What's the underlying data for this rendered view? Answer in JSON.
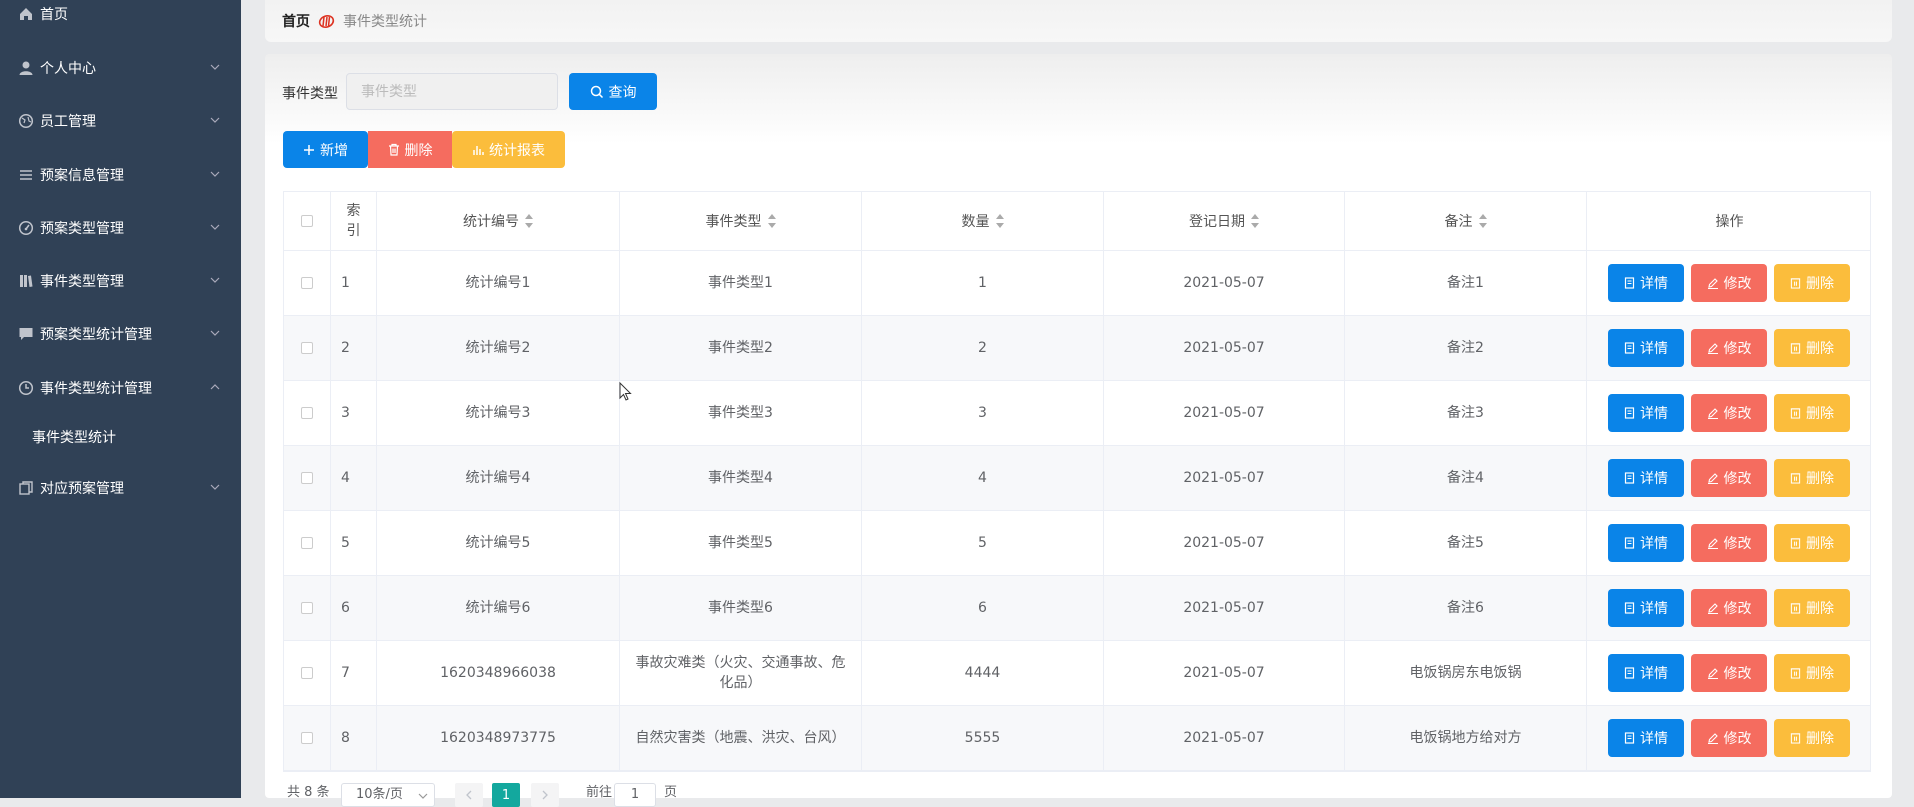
{
  "sidebar": {
    "items": [
      {
        "label": "首页",
        "icon": "home-icon"
      },
      {
        "label": "个人中心",
        "icon": "user-icon"
      },
      {
        "label": "员工管理",
        "icon": "globe-icon"
      },
      {
        "label": "预案信息管理",
        "icon": "list-icon"
      },
      {
        "label": "预案类型管理",
        "icon": "dashboard-icon"
      },
      {
        "label": "事件类型管理",
        "icon": "books-icon"
      },
      {
        "label": "预案类型统计管理",
        "icon": "comment-icon"
      },
      {
        "label": "事件类型统计管理",
        "icon": "clock-icon"
      },
      {
        "label": "对应预案管理",
        "icon": "copy-icon"
      }
    ],
    "subitem": "事件类型统计"
  },
  "breadcrumb": {
    "home": "首页",
    "current": "事件类型统计"
  },
  "search": {
    "label": "事件类型",
    "placeholder": "事件类型",
    "button": "查询"
  },
  "toolbar": {
    "add": "新增",
    "delete": "删除",
    "report": "统计报表"
  },
  "table": {
    "headers": {
      "index": "索引",
      "code": "统计编号",
      "type": "事件类型",
      "count": "数量",
      "date": "登记日期",
      "note": "备注",
      "action": "操作"
    },
    "actions": {
      "detail": "详情",
      "edit": "修改",
      "delete": "删除"
    },
    "rows": [
      {
        "index": "1",
        "code": "统计编号1",
        "type": "事件类型1",
        "count": "1",
        "date": "2021-05-07",
        "note": "备注1"
      },
      {
        "index": "2",
        "code": "统计编号2",
        "type": "事件类型2",
        "count": "2",
        "date": "2021-05-07",
        "note": "备注2"
      },
      {
        "index": "3",
        "code": "统计编号3",
        "type": "事件类型3",
        "count": "3",
        "date": "2021-05-07",
        "note": "备注3"
      },
      {
        "index": "4",
        "code": "统计编号4",
        "type": "事件类型4",
        "count": "4",
        "date": "2021-05-07",
        "note": "备注4"
      },
      {
        "index": "5",
        "code": "统计编号5",
        "type": "事件类型5",
        "count": "5",
        "date": "2021-05-07",
        "note": "备注5"
      },
      {
        "index": "6",
        "code": "统计编号6",
        "type": "事件类型6",
        "count": "6",
        "date": "2021-05-07",
        "note": "备注6"
      },
      {
        "index": "7",
        "code": "1620348966038",
        "type": "事故灾难类（火灾、交通事故、危化品）",
        "count": "4444",
        "date": "2021-05-07",
        "note": "电饭锅房东电饭锅"
      },
      {
        "index": "8",
        "code": "1620348973775",
        "type": "自然灾害类（地震、洪灾、台风）",
        "count": "5555",
        "date": "2021-05-07",
        "note": "电饭锅地方给对方"
      }
    ]
  },
  "pagination": {
    "total": "共 8 条",
    "page_size": "10条/页",
    "current_page": "1",
    "goto_prefix": "前往",
    "goto_value": "1",
    "goto_suffix": "页"
  },
  "colors": {
    "sidebar": "#304156",
    "primary": "#0a84e8",
    "danger": "#f56c5f",
    "warning": "#fbbd3c",
    "page_active": "#13a89e"
  }
}
